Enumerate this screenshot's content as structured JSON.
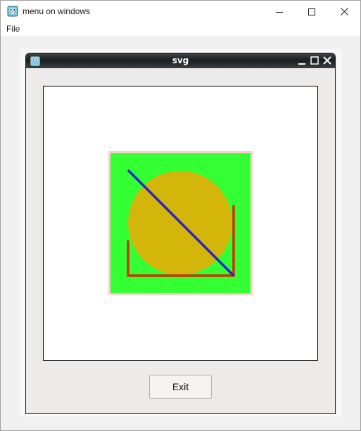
{
  "window": {
    "title": "menu on windows",
    "icons": {
      "app": "gopher-app-icon",
      "minimize": "minimize-icon",
      "maximize": "maximize-icon",
      "close": "close-icon"
    }
  },
  "menubar": {
    "items": [
      {
        "label": "File"
      }
    ]
  },
  "dialog": {
    "title": "svg",
    "icons": {
      "app": "gopher-app-icon",
      "minimize": "minimize-icon",
      "maximize": "maximize-icon",
      "close": "close-icon"
    },
    "exit_label": "Exit"
  },
  "svg_image": {
    "background_color": "#33ff33",
    "border_color": "#ffcccc",
    "circle_color": "#d4b509",
    "bracket_color": "#cc3300",
    "diagonal_color": "#2222dd"
  }
}
